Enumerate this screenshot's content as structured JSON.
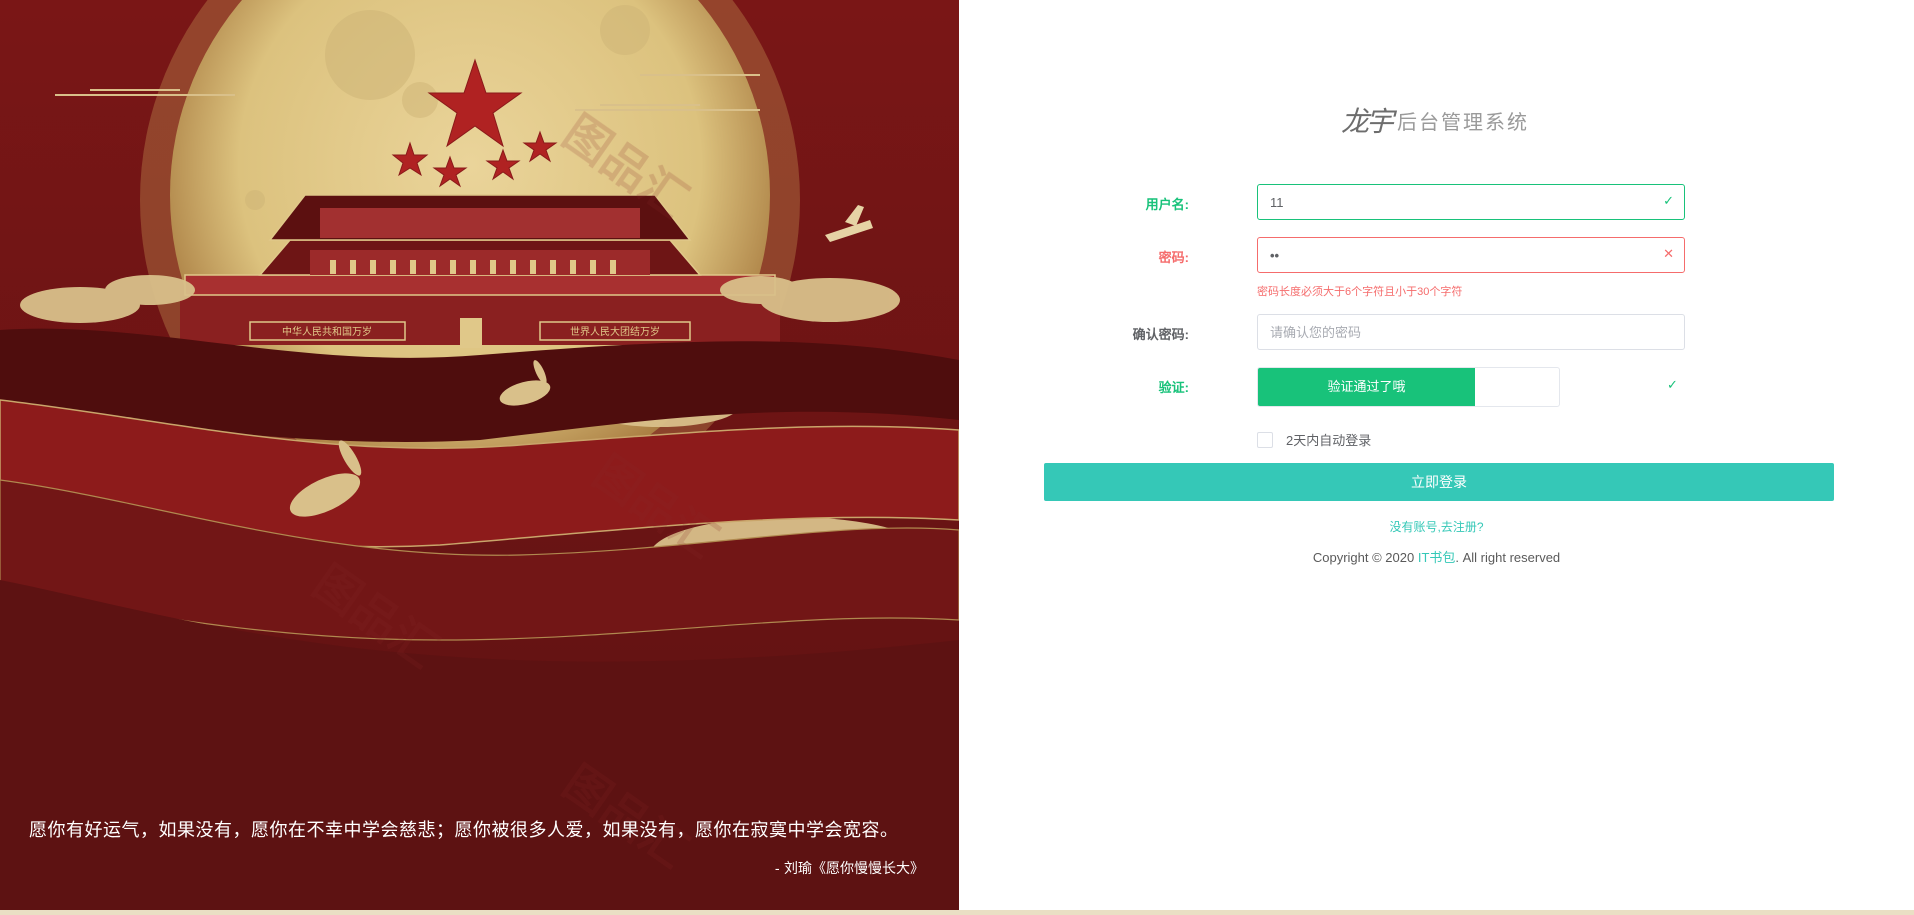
{
  "hero": {
    "quote": "愿你有好运气，如果没有，愿你在不幸中学会慈悲；愿你被很多人爱，如果没有，愿你在寂寞中学会宽容。",
    "author": "- 刘瑜《愿你慢慢长大》",
    "banner_left": "中华人民共和国万岁",
    "banner_right": "世界人民大团结万岁",
    "watermark": "图品汇",
    "colors": {
      "background": "#6b1414",
      "moon": "#e6cf8c",
      "cloud": "#d9c08a",
      "star": "#b02222"
    }
  },
  "login": {
    "logo_mark": "龙宇",
    "title": "后台管理系统",
    "username": {
      "label": "用户名:",
      "value": "11",
      "placeholder": "",
      "state_icon": "check-icon"
    },
    "password": {
      "label": "密码:",
      "value": "••",
      "state_icon": "close-icon",
      "error": "密码长度必须大于6个字符且小于30个字符"
    },
    "confirm": {
      "label": "确认密码:",
      "value": "",
      "placeholder": "请确认您的密码"
    },
    "verify": {
      "label": "验证:",
      "slider_text": "验证通过了哦",
      "progress": 0.72,
      "state_icon": "check-icon"
    },
    "remember_label": "2天内自动登录",
    "submit_label": "立即登录",
    "register_link": "没有账号,去注册?",
    "copyright_prefix": "Copyright © 2020",
    "copyright_brand": "IT书包",
    "copyright_suffix": ". All right reserved",
    "colors": {
      "accent": "#35c8b7",
      "success": "#18c27a",
      "error": "#f56c6c"
    }
  }
}
